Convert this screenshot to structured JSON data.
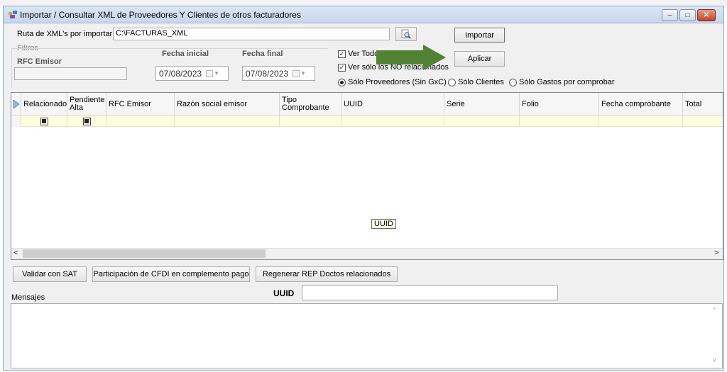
{
  "window": {
    "title": "Importar / Consultar XML de Proveedores Y Clientes de otros facturadores"
  },
  "import": {
    "path_label": "Ruta de XML's por importar",
    "path_value": "C:\\FACTURAS_XML",
    "import_button": "Importar",
    "apply_button": "Aplicar"
  },
  "filters": {
    "group_label": "Filtros",
    "rfc_label": "RFC Emisor",
    "rfc_value": "",
    "fecha_inicial_label": "Fecha inicial",
    "fecha_inicial_value": "07/08/2023",
    "fecha_final_label": "Fecha final",
    "fecha_final_value": "07/08/2023"
  },
  "options": {
    "ver_todos_label": "Ver Todos",
    "ver_todos_checked": true,
    "ver_no_relacionados_label": "Ver sólo los NO relacionados",
    "ver_no_relacionados_checked": true,
    "radios": [
      {
        "label": "Sólo Proveedores (Sin GxC)",
        "selected": true
      },
      {
        "label": "Sólo Clientes",
        "selected": false
      },
      {
        "label": "Sólo Gastos por comprobar",
        "selected": false
      }
    ]
  },
  "grid": {
    "columns": [
      "Relacionado",
      "Pendiente Alta",
      "RFC Emisor",
      "Razón social emisor",
      "Tipo Comprobante",
      "UUID",
      "Serie",
      "Folio",
      "Fecha comprobante",
      "Total"
    ],
    "tooltip": "UUID",
    "scroll_left": "<",
    "scroll_right": ">"
  },
  "actions": {
    "validar": "Validar con SAT",
    "participacion": "Participación de CFDI en complemento pago",
    "regenerar": "Regenerar  REP Doctos relacionados"
  },
  "messages": {
    "label": "Mensajes",
    "uuid_label": "UUID",
    "uuid_value": ""
  },
  "colors": {
    "arrow": "#538135",
    "grid_new_row": "#ffffe0",
    "title_bar": "#c7d7ec"
  }
}
